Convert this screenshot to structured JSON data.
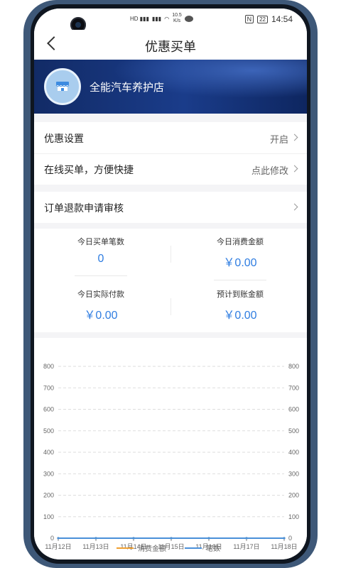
{
  "status_bar": {
    "speed_value": "10.5",
    "speed_unit": "K/s",
    "battery": "22",
    "time": "14:54",
    "nfc": "N"
  },
  "header": {
    "title": "优惠买单"
  },
  "store": {
    "name": "全能汽车养护店"
  },
  "settings": [
    {
      "label": "优惠设置",
      "value": "开启"
    },
    {
      "label": "在线买单，方便快捷",
      "value": "点此修改"
    }
  ],
  "refund": {
    "label": "订单退款申请审核"
  },
  "stats": {
    "today_orders": {
      "label": "今日买单笔数",
      "value": "0"
    },
    "today_consume": {
      "label": "今日消费金额",
      "value": "￥0.00"
    },
    "today_paid": {
      "label": "今日实际付款",
      "value": "￥0.00"
    },
    "expected": {
      "label": "预计到账金额",
      "value": "￥0.00"
    }
  },
  "colors": {
    "accent": "#2f7de1",
    "series_amount": "#f0a030",
    "series_count": "#4a90d9"
  },
  "chart_data": {
    "type": "line",
    "categories": [
      "11月12日",
      "11月13日",
      "11月14日",
      "11月15日",
      "11月16日",
      "11月17日",
      "11月18日"
    ],
    "ylim": [
      0,
      800
    ],
    "yticks": [
      0,
      100,
      200,
      300,
      400,
      500,
      600,
      700,
      800
    ],
    "series": [
      {
        "name": "消费金额",
        "values": [
          0,
          0,
          0,
          0,
          0,
          0,
          0
        ]
      },
      {
        "name": "笔数",
        "values": [
          0,
          0,
          0,
          0,
          0,
          0,
          0
        ]
      }
    ],
    "grid": true,
    "legend": "bottom"
  }
}
